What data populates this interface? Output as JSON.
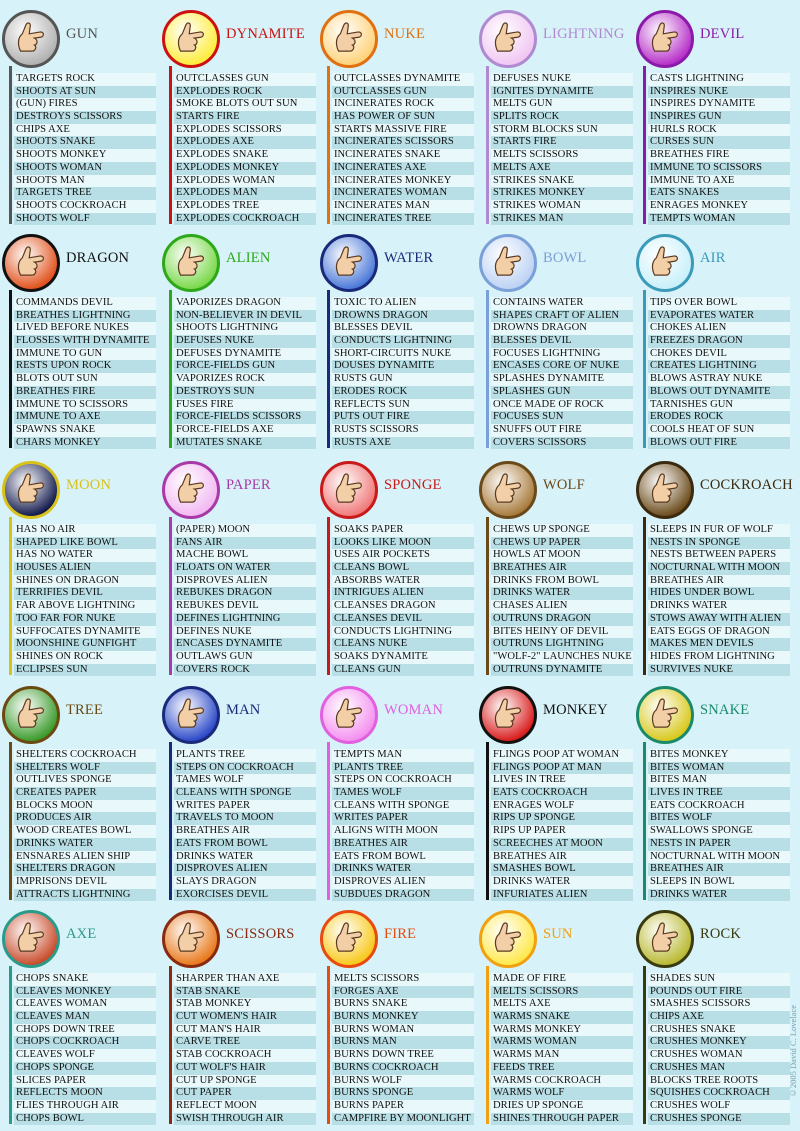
{
  "copyright": "©2005 David C. Lovelace",
  "cells": [
    {
      "name": "GUN",
      "color": "#555555",
      "icon_color": "#b0b0b0",
      "icon": "pointing-hand-icon",
      "items": [
        "TARGETS ROCK",
        "SHOOTS AT SUN",
        "(GUN) FIRES",
        "DESTROYS SCISSORS",
        "CHIPS AXE",
        "SHOOTS SNAKE",
        "SHOOTS MONKEY",
        "SHOOTS WOMAN",
        "SHOOTS MAN",
        "TARGETS TREE",
        "SHOOTS COCKROACH",
        "SHOOTS WOLF"
      ]
    },
    {
      "name": "DYNAMITE",
      "color": "#cc1111",
      "icon_color": "#ffec3a",
      "icon": "thumbs-up-icon",
      "items": [
        "OUTCLASSES GUN",
        "EXPLODES ROCK",
        "SMOKE BLOTS OUT SUN",
        "STARTS FIRE",
        "EXPLODES SCISSORS",
        "EXPLODES AXE",
        "EXPLODES SNAKE",
        "EXPLODES MONKEY",
        "EXPLODES WOMAN",
        "EXPLODES MAN",
        "EXPLODES TREE",
        "EXPLODES COCKROACH"
      ]
    },
    {
      "name": "NUKE",
      "color": "#e07010",
      "icon_color": "#ffd27a",
      "icon": "open-hand-icon",
      "items": [
        "OUTCLASSES DYNAMITE",
        "OUTCLASSES GUN",
        "INCINERATES ROCK",
        "HAS POWER OF SUN",
        "STARTS MASSIVE FIRE",
        "INCINERATES SCISSORS",
        "INCINERATES SNAKE",
        "INCINERATES AXE",
        "INCINERATES MONKEY",
        "INCINERATES WOMAN",
        "INCINERATES MAN",
        "INCINERATES TREE"
      ]
    },
    {
      "name": "LIGHTNING",
      "color": "#b08ad0",
      "icon_color": "#f0c6f3",
      "icon": "pinch-hand-icon",
      "items": [
        "DEFUSES NUKE",
        "IGNITES DYNAMITE",
        "MELTS GUN",
        "SPLITS ROCK",
        "STORM BLOCKS SUN",
        "STARTS FIRE",
        "MELTS SCISSORS",
        "MELTS AXE",
        "STRIKES SNAKE",
        "STRIKES MONKEY",
        "STRIKES WOMAN",
        "STRIKES MAN"
      ]
    },
    {
      "name": "DEVIL",
      "color": "#8a1aa8",
      "icon_color": "#b62ec8",
      "icon": "horns-hand-icon",
      "items": [
        "CASTS LIGHTNING",
        "INSPIRES NUKE",
        "INSPIRES DYNAMITE",
        "INSPIRES GUN",
        "HURLS ROCK",
        "CURSES SUN",
        "BREATHES FIRE",
        "IMMUNE TO SCISSORS",
        "IMMUNE TO AXE",
        "EATS SNAKES",
        "ENRAGES MONKEY",
        "TEMPTS WOMAN"
      ]
    },
    {
      "name": "DRAGON",
      "color": "#111111",
      "icon_color": "#e0501a",
      "icon": "dragon-hand-icon",
      "items": [
        "COMMANDS DEVIL",
        "BREATHES LIGHTNING",
        "LIVED BEFORE NUKES",
        "FLOSSES WITH DYNAMITE",
        "IMMUNE TO GUN",
        "RESTS UPON ROCK",
        "BLOTS OUT SUN",
        "BREATHES FIRE",
        "IMMUNE TO SCISSORS",
        "IMMUNE TO AXE",
        "SPAWNS SNAKE",
        "CHARS MONKEY"
      ]
    },
    {
      "name": "ALIEN",
      "color": "#2ea81a",
      "icon_color": "#7ad84a",
      "icon": "vulcan-hand-icon",
      "items": [
        "VAPORIZES DRAGON",
        "NON-BELIEVER IN DEVIL",
        "SHOOTS LIGHTNING",
        "DEFUSES NUKE",
        "DEFUSES DYNAMITE",
        "FORCE-FIELDS GUN",
        "VAPORIZES ROCK",
        "DESTROYS SUN",
        "FUSES FIRE",
        "FORCE-FIELDS SCISSORS",
        "FORCE-FIELDS AXE",
        "MUTATES SNAKE"
      ]
    },
    {
      "name": "WATER",
      "color": "#1a2a7a",
      "icon_color": "#4a78d8",
      "icon": "dripping-hand-icon",
      "items": [
        "TOXIC TO ALIEN",
        "DROWNS DRAGON",
        "BLESSES DEVIL",
        "CONDUCTS LIGHTNING",
        "SHORT-CIRCUITS NUKE",
        "DOUSES DYNAMITE",
        "RUSTS GUN",
        "ERODES ROCK",
        "REFLECTS SUN",
        "PUTS OUT FIRE",
        "RUSTS SCISSORS",
        "RUSTS AXE"
      ]
    },
    {
      "name": "BOWL",
      "color": "#7aa0d8",
      "icon_color": "#bcd2f4",
      "icon": "cupped-hand-icon",
      "items": [
        "CONTAINS WATER",
        "SHAPES CRAFT OF ALIEN",
        "DROWNS DRAGON",
        "BLESSES DEVIL",
        "FOCUSES LIGHTNING",
        "ENCASES CORE OF NUKE",
        "SPLASHES DYNAMITE",
        "SPLASHES GUN",
        "ONCE MADE OF ROCK",
        "FOCUSES SUN",
        "SNUFFS OUT FIRE",
        "COVERS SCISSORS"
      ]
    },
    {
      "name": "AIR",
      "color": "#3a9ab8",
      "icon_color": "#c8f0fa",
      "icon": "ok-hand-icon",
      "items": [
        "TIPS OVER BOWL",
        "EVAPORATES WATER",
        "CHOKES ALIEN",
        "FREEZES DRAGON",
        "CHOKES DEVIL",
        "CREATES LIGHTNING",
        "BLOWS ASTRAY NUKE",
        "BLOWS OUT DYNAMITE",
        "TARNISHES GUN",
        "ERODES ROCK",
        "COOLS HEAT OF SUN",
        "BLOWS OUT FIRE"
      ]
    },
    {
      "name": "MOON",
      "color": "#d8c21a",
      "icon_color": "#10184a",
      "icon": "moon-hand-icon",
      "items": [
        "HAS NO AIR",
        "SHAPED LIKE BOWL",
        "HAS NO WATER",
        "HOUSES ALIEN",
        "SHINES ON DRAGON",
        "TERRIFIES DEVIL",
        "FAR ABOVE LIGHTNING",
        "TOO FAR FOR NUKE",
        "SUFFOCATES DYNAMITE",
        "MOONSHINE GUNFIGHT",
        "SHINES ON ROCK",
        "ECLIPSES SUN"
      ]
    },
    {
      "name": "PAPER",
      "color": "#a83aa8",
      "icon_color": "#f2b8f2",
      "icon": "flat-hand-icon",
      "items": [
        "(PAPER) MOON",
        "FANS AIR",
        "MACHE BOWL",
        "FLOATS ON WATER",
        "DISPROVES ALIEN",
        "REBUKES DRAGON",
        "REBUKES DEVIL",
        "DEFINES LIGHTNING",
        "DEFINES NUKE",
        "ENCASES DYNAMITE",
        "OUTLAWS GUN",
        "COVERS ROCK"
      ]
    },
    {
      "name": "SPONGE",
      "color": "#c81a1a",
      "icon_color": "#f07878",
      "icon": "squeeze-hand-icon",
      "items": [
        "SOAKS PAPER",
        "LOOKS LIKE MOON",
        "USES AIR POCKETS",
        "CLEANS BOWL",
        "ABSORBS WATER",
        "INTRIGUES ALIEN",
        "CLEANSES DRAGON",
        "CLEANSES DEVIL",
        "CONDUCTS LIGHTNING",
        "CLEANS NUKE",
        "SOAKS DYNAMITE",
        "CLEANS GUN"
      ]
    },
    {
      "name": "WOLF",
      "color": "#6a4a1a",
      "icon_color": "#a87a3a",
      "icon": "wolf-hand-icon",
      "items": [
        "CHEWS UP SPONGE",
        "CHEWS UP PAPER",
        "HOWLS AT MOON",
        "BREATHES AIR",
        "DRINKS FROM BOWL",
        "DRINKS WATER",
        "CHASES ALIEN",
        "OUTRUNS DRAGON",
        "BITES HEINY OF DEVIL",
        "OUTRUNS LIGHTNING",
        "\"WOLF-2\" LAUNCHES NUKE",
        "OUTRUNS DYNAMITE"
      ]
    },
    {
      "name": "COCKROACH",
      "color": "#3a2a10",
      "icon_color": "#6a4a1a",
      "icon": "crawling-hand-icon",
      "items": [
        "SLEEPS IN FUR OF WOLF",
        "NESTS IN SPONGE",
        "NESTS BETWEEN PAPERS",
        "NOCTURNAL WITH MOON",
        "BREATHES AIR",
        "HIDES UNDER BOWL",
        "DRINKS WATER",
        "STOWS AWAY WITH ALIEN",
        "EATS EGGS OF DRAGON",
        "MAKES MEN DEVILS",
        "HIDES FROM LIGHTNING",
        "SURVIVES NUKE"
      ]
    },
    {
      "name": "TREE",
      "color": "#6a4a10",
      "icon_color": "#3a9a2a",
      "icon": "tree-hand-icon",
      "items": [
        "SHELTERS COCKROACH",
        "SHELTERS WOLF",
        "OUTLIVES SPONGE",
        "CREATES PAPER",
        "BLOCKS MOON",
        "PRODUCES AIR",
        "WOOD CREATES BOWL",
        "DRINKS WATER",
        "ENSNARES ALIEN SHIP",
        "SHELTERS DRAGON",
        "IMPRISONS DEVIL",
        "ATTRACTS LIGHTNING"
      ]
    },
    {
      "name": "MAN",
      "color": "#1a2a7a",
      "icon_color": "#2a48c8",
      "icon": "walking-hand-icon",
      "items": [
        "PLANTS TREE",
        "STEPS ON COCKROACH",
        "TAMES WOLF",
        "CLEANS WITH SPONGE",
        "WRITES PAPER",
        "TRAVELS TO MOON",
        "BREATHES AIR",
        "EATS FROM BOWL",
        "DRINKS WATER",
        "DISPROVES ALIEN",
        "SLAYS DRAGON",
        "EXORCISES DEVIL"
      ]
    },
    {
      "name": "WOMAN",
      "color": "#e060e0",
      "icon_color": "#f490f0",
      "icon": "graceful-hand-icon",
      "items": [
        "TEMPTS MAN",
        "PLANTS TREE",
        "STEPS ON COCKROACH",
        "TAMES WOLF",
        "CLEANS WITH SPONGE",
        "WRITES PAPER",
        "ALIGNS WITH MOON",
        "BREATHES AIR",
        "EATS FROM BOWL",
        "DRINKS WATER",
        "DISPROVES ALIEN",
        "SUBDUES DRAGON"
      ]
    },
    {
      "name": "MONKEY",
      "color": "#111111",
      "icon_color": "#d81a1a",
      "icon": "curled-hand-icon",
      "items": [
        "FLINGS POOP AT WOMAN",
        "FLINGS POOP AT MAN",
        "LIVES IN TREE",
        "EATS COCKROACH",
        "ENRAGES WOLF",
        "RIPS UP SPONGE",
        "RIPS UP PAPER",
        "SCREECHES AT MOON",
        "BREATHES AIR",
        "SMASHES BOWL",
        "DRINKS WATER",
        "INFURIATES ALIEN"
      ]
    },
    {
      "name": "SNAKE",
      "color": "#1a8a6a",
      "icon_color": "#d8c81a",
      "icon": "snake-hand-icon",
      "items": [
        "BITES MONKEY",
        "BITES WOMAN",
        "BITES MAN",
        "LIVES IN TREE",
        "EATS COCKROACH",
        "BITES WOLF",
        "SWALLOWS SPONGE",
        "NESTS IN PAPER",
        "NOCTURNAL WITH MOON",
        "BREATHES AIR",
        "SLEEPS IN BOWL",
        "DRINKS WATER"
      ]
    },
    {
      "name": "AXE",
      "color": "#2a9a8a",
      "icon_color": "#c84a2a",
      "icon": "chop-hand-icon",
      "items": [
        "CHOPS SNAKE",
        "CLEAVES MONKEY",
        "CLEAVES WOMAN",
        "CLEAVES MAN",
        "CHOPS DOWN TREE",
        "CHOPS COCKROACH",
        "CLEAVES WOLF",
        "CHOPS SPONGE",
        "SLICES PAPER",
        "REFLECTS MOON",
        "FLIES THROUGH AIR",
        "CHOPS BOWL"
      ]
    },
    {
      "name": "SCISSORS",
      "color": "#8a2a10",
      "icon_color": "#e8781a",
      "icon": "v-hand-icon",
      "items": [
        "SHARPER THAN AXE",
        "STAB SNAKE",
        "STAB MONKEY",
        "CUT WOMEN'S HAIR",
        "CUT MAN'S HAIR",
        "CARVE TREE",
        "STAB COCKROACH",
        "CUT WOLF'S HAIR",
        "CUT UP SPONGE",
        "CUT PAPER",
        "REFLECT MOON",
        "SWISH THROUGH AIR"
      ]
    },
    {
      "name": "FIRE",
      "color": "#e84a10",
      "icon_color": "#f8c81a",
      "icon": "raised-fingers-icon",
      "items": [
        "MELTS SCISSORS",
        "FORGES AXE",
        "BURNS SNAKE",
        "BURNS MONKEY",
        "BURNS WOMAN",
        "BURNS MAN",
        "BURNS DOWN TREE",
        "BURNS COCKROACH",
        "BURNS WOLF",
        "BURNS SPONGE",
        "BURNS PAPER",
        "CAMPFIRE BY MOONLIGHT"
      ]
    },
    {
      "name": "SUN",
      "color": "#f0a010",
      "icon_color": "#ffe84a",
      "icon": "spread-hand-icon",
      "items": [
        "MADE OF FIRE",
        "MELTS SCISSORS",
        "MELTS AXE",
        "WARMS SNAKE",
        "WARMS MONKEY",
        "WARMS WOMAN",
        "WARMS MAN",
        "FEEDS TREE",
        "WARMS COCKROACH",
        "WARMS WOLF",
        "DRIES UP SPONGE",
        "SHINES THROUGH PAPER"
      ]
    },
    {
      "name": "ROCK",
      "color": "#3a3a10",
      "icon_color": "#b8b830",
      "icon": "fist-icon",
      "items": [
        "SHADES SUN",
        "POUNDS OUT FIRE",
        "SMASHES SCISSORS",
        "CHIPS AXE",
        "CRUSHES SNAKE",
        "CRUSHES MONKEY",
        "CRUSHES WOMAN",
        "CRUSHES MAN",
        "BLOCKS TREE ROOTS",
        "SQUISHES COCKROACH",
        "CRUSHES WOLF",
        "CRUSHES SPONGE"
      ]
    }
  ]
}
